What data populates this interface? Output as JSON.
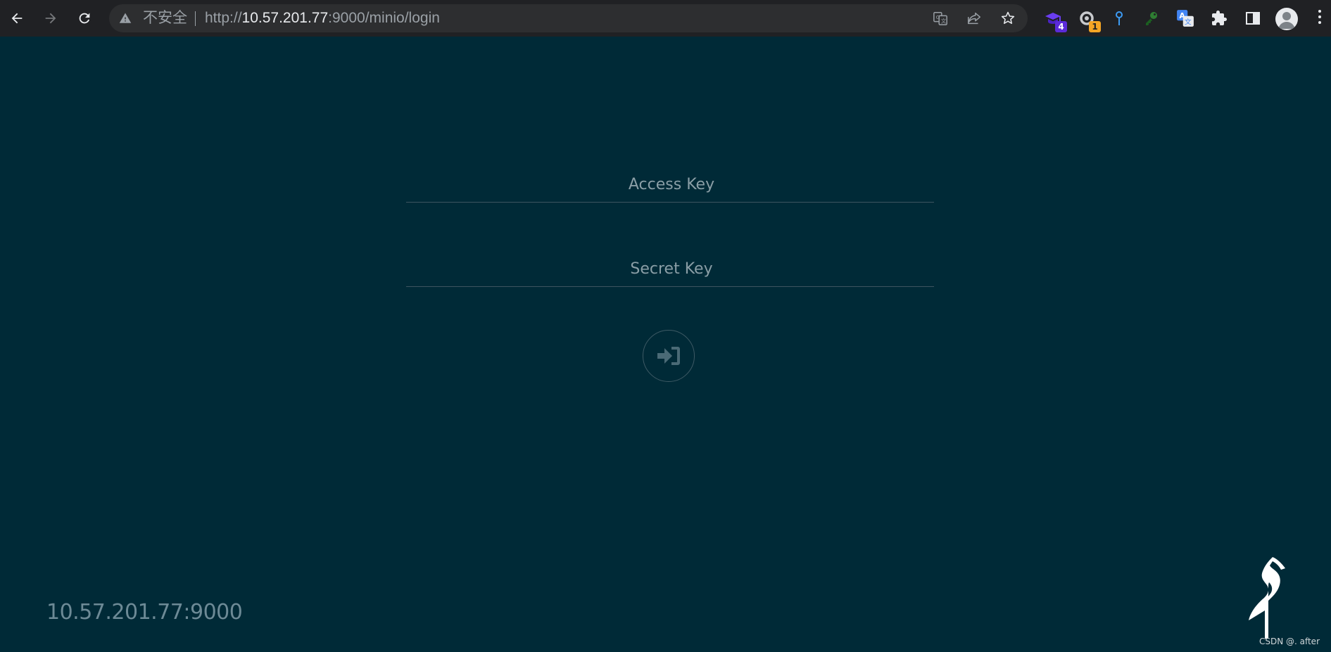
{
  "browser": {
    "security_label": "不安全",
    "url_scheme": "http://",
    "url_host": "10.57.201.77",
    "url_rest": ":9000/minio/login",
    "extensions": [
      {
        "name": "ext-purple",
        "badge": "4",
        "badge_color": "#5b2bd9"
      },
      {
        "name": "ext-loop",
        "badge": "1",
        "badge_color": "#f5a524"
      }
    ]
  },
  "login": {
    "access_key_placeholder": "Access Key",
    "secret_key_placeholder": "Secret Key",
    "login_icon": "sign-in-icon"
  },
  "footer": {
    "host": "10.57.201.77:9000",
    "watermark": "CSDN @. after"
  },
  "colors": {
    "background": "#002a37",
    "chrome": "#202124",
    "omnibox": "#2d2e30",
    "field_line": "#3d5560",
    "placeholder": "#8a9ea6"
  }
}
